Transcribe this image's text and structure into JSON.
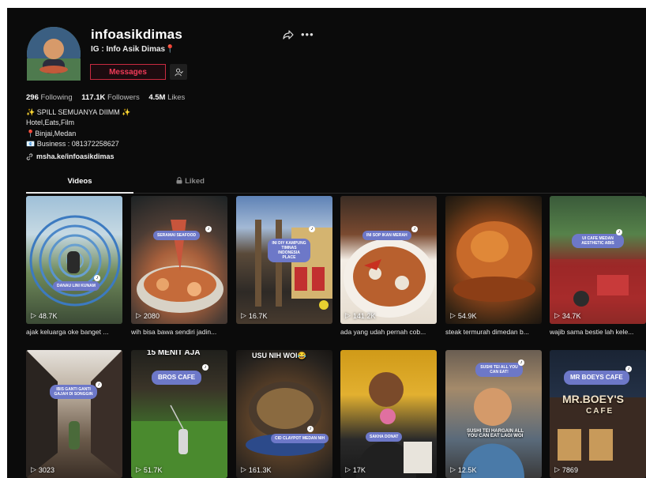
{
  "profile": {
    "username": "infoasikdimas",
    "subtitle": "IG : Info Asik Dimas📍",
    "messages_label": "Messages"
  },
  "stats": {
    "following_count": "296",
    "following_label": "Following",
    "followers_count": "117.1K",
    "followers_label": "Followers",
    "likes_count": "4.5M",
    "likes_label": "Likes"
  },
  "bio": {
    "lines": [
      "✨ SPILL SEMUANYA DIIMM ✨",
      "Hotel,Eats,Film",
      "📍Binjai,Medan",
      "📧 Business : 081372258627"
    ],
    "link": "msha.ke/infoasikdimas"
  },
  "tabs": {
    "videos": "Videos",
    "liked": "Liked"
  },
  "videos": [
    {
      "views": "48.7K",
      "caption": "ajak keluarga oke banget ...",
      "tag": "DANAU LINI KUNAM"
    },
    {
      "views": "2080",
      "caption": "wih bisa bawa sendiri jadin...",
      "tag": "SERAMAI SEAFOOD"
    },
    {
      "views": "16.7K",
      "caption": "",
      "tag": "INI DIY KAMPUNG TIMNAS INDONESIA PLACE"
    },
    {
      "views": "141.2K",
      "caption": "ada yang udah pernah cob...",
      "tag": "INI SOP IKAN MERAH"
    },
    {
      "views": "54.9K",
      "caption": "steak termurah dimedan b...",
      "tag": ""
    },
    {
      "views": "34.7K",
      "caption": "wajib sama bestie lah kele...",
      "tag": "UI CAFE MEDAN AESTHETIC ABIS"
    },
    {
      "views": "3023",
      "caption": "",
      "tag": "IBIS GANTI GANTI GAJAH DI SONGGIN"
    },
    {
      "views": "51.7K",
      "caption": "",
      "tag": "BROS CAFE",
      "title": "15 MENIT AJA"
    },
    {
      "views": "161.3K",
      "caption": "",
      "tag": "CID CLAYPOT MEDAN NIH",
      "title": "USU NIH WOI😂"
    },
    {
      "views": "17K",
      "caption": "",
      "tag": "SAKHA DONAT"
    },
    {
      "views": "12.5K",
      "caption": "",
      "tag": "SUSHI TEI ALL YOU CAN EAT!",
      "subtitle": "SUSHI TEI HARGAIN ALL YOU CAN EAT LAGI WOI"
    },
    {
      "views": "7869",
      "caption": "",
      "tag": "MR BOEYS CAFE",
      "sign1": "MR.BOEY'S",
      "sign2": "CAFE"
    }
  ]
}
